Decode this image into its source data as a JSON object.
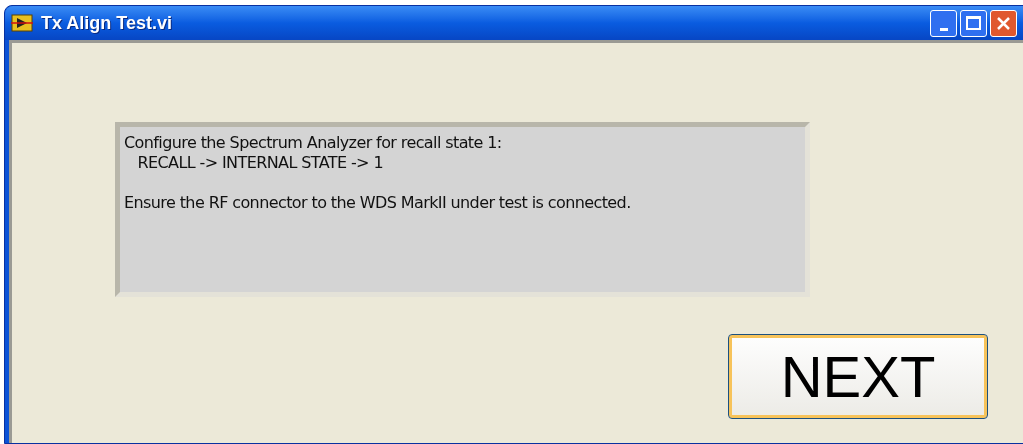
{
  "window": {
    "title": "Tx Align Test.vi"
  },
  "message": {
    "paragraphs": [
      [
        "Configure the Spectrum Analyzer for recall state 1:",
        "   RECALL -> INTERNAL STATE -> 1"
      ],
      [
        "Ensure the RF connector to the WDS MarkII under test is connected."
      ]
    ]
  },
  "button": {
    "label": "NEXT",
    "focused": true
  }
}
